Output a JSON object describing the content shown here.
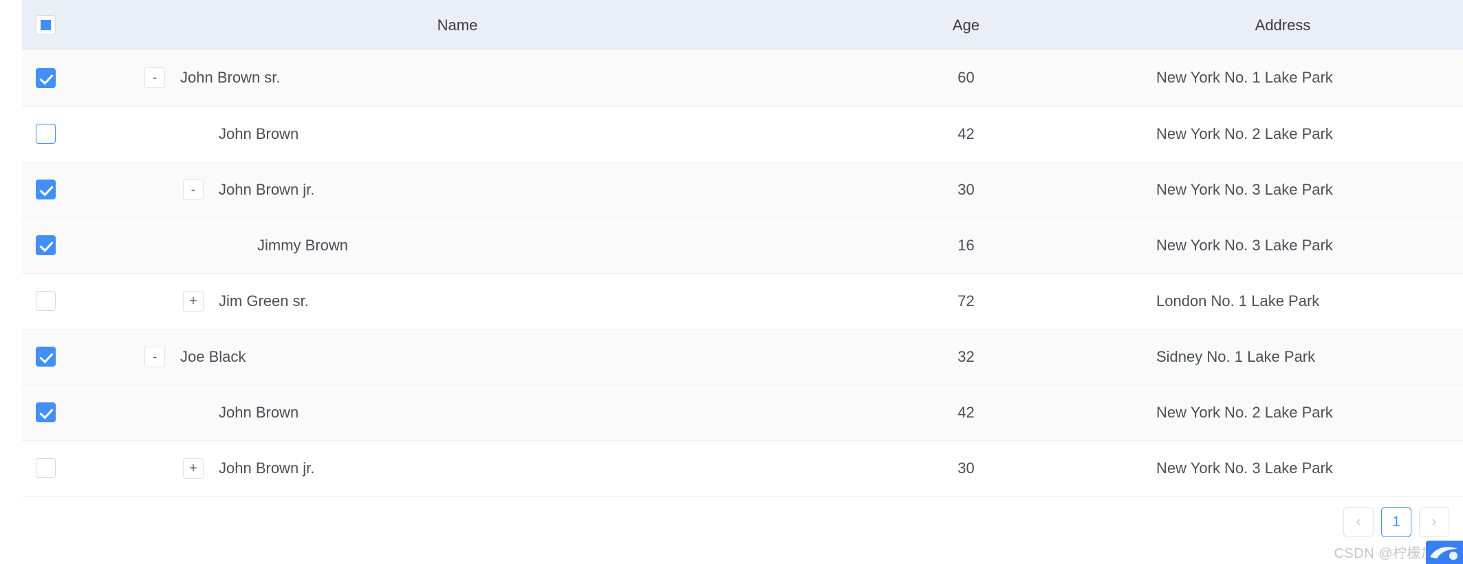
{
  "table": {
    "columns": [
      {
        "key": "selection",
        "label": "",
        "icon": "checkbox-indeterminate-icon"
      },
      {
        "key": "name",
        "label": "Name"
      },
      {
        "key": "age",
        "label": "Age"
      },
      {
        "key": "address",
        "label": "Address"
      }
    ],
    "header_select_all_state": "indeterminate",
    "rows": [
      {
        "name": "John Brown sr.",
        "age": "60",
        "address": "New York No. 1 Lake Park",
        "level": 0,
        "toggle": "-",
        "checked": true,
        "checkbox_state": "checked",
        "stripe": "gray"
      },
      {
        "name": "John Brown",
        "age": "42",
        "address": "New York No. 2 Lake Park",
        "level": 1,
        "toggle": "",
        "checked": false,
        "checkbox_state": "unchecked-hover",
        "stripe": "white"
      },
      {
        "name": "John Brown jr.",
        "age": "30",
        "address": "New York No. 3 Lake Park",
        "level": 1,
        "toggle": "-",
        "checked": true,
        "checkbox_state": "checked",
        "stripe": "gray"
      },
      {
        "name": "Jimmy Brown",
        "age": "16",
        "address": "New York No. 3 Lake Park",
        "level": 2,
        "toggle": "",
        "checked": true,
        "checkbox_state": "checked",
        "stripe": "gray"
      },
      {
        "name": "Jim Green sr.",
        "age": "72",
        "address": "London No. 1 Lake Park",
        "level": 1,
        "toggle": "+",
        "checked": false,
        "checkbox_state": "unchecked",
        "stripe": "white"
      },
      {
        "name": "Joe Black",
        "age": "32",
        "address": "Sidney No. 1 Lake Park",
        "level": 0,
        "toggle": "-",
        "checked": true,
        "checkbox_state": "checked",
        "stripe": "gray"
      },
      {
        "name": "John Brown",
        "age": "42",
        "address": "New York No. 2 Lake Park",
        "level": 1,
        "toggle": "",
        "checked": true,
        "checkbox_state": "checked",
        "stripe": "gray"
      },
      {
        "name": "John Brown jr.",
        "age": "30",
        "address": "New York No. 3 Lake Park",
        "level": 1,
        "toggle": "+",
        "checked": false,
        "checkbox_state": "unchecked",
        "stripe": "white"
      }
    ]
  },
  "pagination": {
    "prev_label": "‹",
    "next_label": "›",
    "pages": [
      {
        "label": "1",
        "active": true
      }
    ],
    "current_page": "1"
  },
  "watermark": {
    "text": "CSDN @柠檬加栎"
  },
  "colors": {
    "accent": "#4290f7",
    "header_bg": "#eaeef7",
    "stripe_gray": "#fafafa",
    "row_border": "#f0f0f0",
    "text": "#4a4f57"
  }
}
